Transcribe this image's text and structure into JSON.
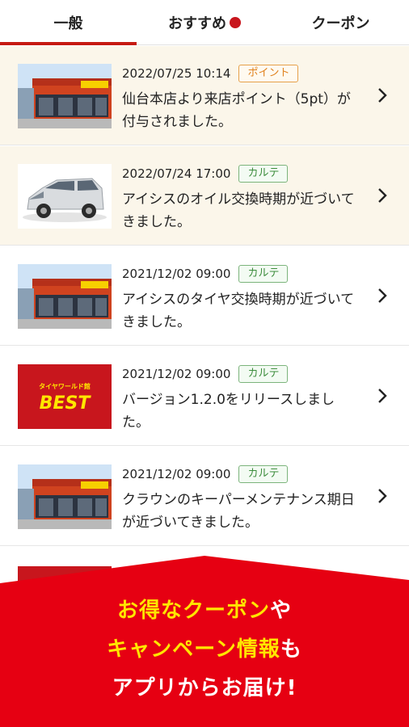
{
  "tabs": [
    {
      "label": "一般"
    },
    {
      "label": "おすすめ"
    },
    {
      "label": "クーポン"
    }
  ],
  "thumb_logo": {
    "small": "タイヤワールド館",
    "big": "BEST"
  },
  "notifications": [
    {
      "date": "2022/07/25 10:14",
      "badge": "ポイント",
      "badge_type": "point",
      "message": "仙台本店より来店ポイント（5pt）が付与されました。",
      "thumb": "store"
    },
    {
      "date": "2022/07/24 17:00",
      "badge": "カルテ",
      "badge_type": "karte",
      "message": "アイシスのオイル交換時期が近づいてきました。",
      "thumb": "car"
    },
    {
      "date": "2021/12/02 09:00",
      "badge": "カルテ",
      "badge_type": "karte",
      "message": "アイシスのタイヤ交換時期が近づいてきました。",
      "thumb": "store"
    },
    {
      "date": "2021/12/02 09:00",
      "badge": "カルテ",
      "badge_type": "karte",
      "message": "バージョン1.2.0をリリースしました。",
      "thumb": "logo"
    },
    {
      "date": "2021/12/02 09:00",
      "badge": "カルテ",
      "badge_type": "karte",
      "message": "クラウンのキーパーメンテナンス期日が近づいてきました。",
      "thumb": "store"
    }
  ],
  "banner": {
    "line1_yellow": "お得なクーポン",
    "line1_white": "や",
    "line2_yellow": "キャンペーン情報",
    "line2_white": "も",
    "line3": "アプリからお届け!"
  },
  "colors": {
    "accent": "#c61a12",
    "banner": "#e60012",
    "highlight": "#ffe600"
  }
}
